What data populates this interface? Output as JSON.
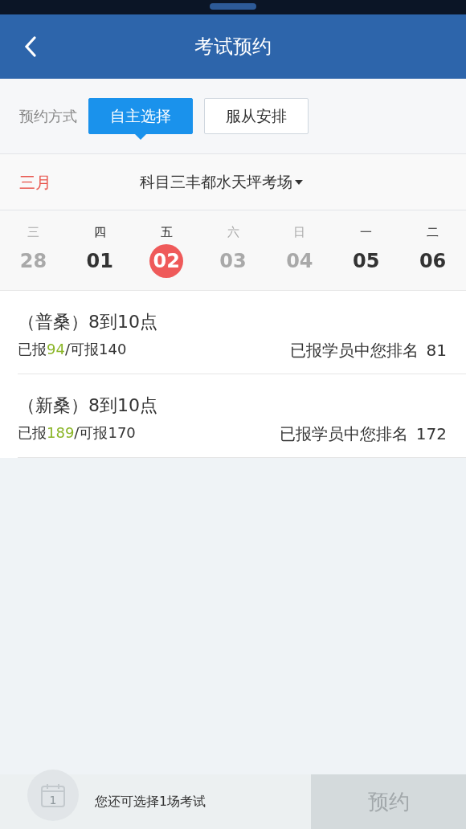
{
  "header": {
    "title": "考试预约"
  },
  "method": {
    "label": "预约方式",
    "options": [
      {
        "label": "自主选择",
        "selected": true
      },
      {
        "label": "服从安排",
        "selected": false
      }
    ]
  },
  "filter": {
    "month": "三月",
    "venue": "科目三丰都水天坪考场"
  },
  "days": [
    {
      "weekday": "三",
      "day": "28",
      "disabled": true,
      "selected": false
    },
    {
      "weekday": "四",
      "day": "01",
      "disabled": false,
      "selected": false
    },
    {
      "weekday": "五",
      "day": "02",
      "disabled": false,
      "selected": true
    },
    {
      "weekday": "六",
      "day": "03",
      "disabled": true,
      "selected": false
    },
    {
      "weekday": "日",
      "day": "04",
      "disabled": true,
      "selected": false
    },
    {
      "weekday": "一",
      "day": "05",
      "disabled": false,
      "selected": false
    },
    {
      "weekday": "二",
      "day": "06",
      "disabled": false,
      "selected": false
    }
  ],
  "sessions": [
    {
      "name": "（普桑）8到10点",
      "enrolled_label": "已报",
      "enrolled": "94",
      "capacity": "/可报140",
      "rank_label": "已报学员中您排名",
      "rank": "81"
    },
    {
      "name": "（新桑）8到10点",
      "enrolled_label": "已报",
      "enrolled": "189",
      "capacity": "/可报170",
      "rank_label": "已报学员中您排名",
      "rank": "172"
    }
  ],
  "footer": {
    "calendar_day": "1",
    "message": "您还可选择1场考试",
    "button": "预约"
  }
}
